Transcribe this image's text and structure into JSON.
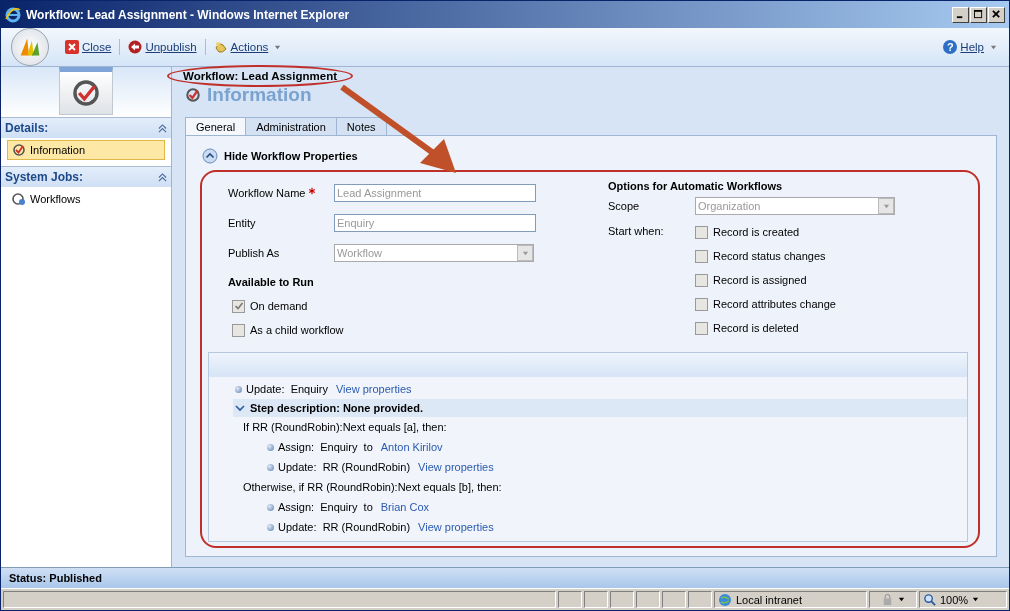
{
  "window": {
    "title": "Workflow: Lead Assignment - Windows Internet Explorer"
  },
  "toolbar": {
    "buttons": [
      {
        "label": "Close",
        "kind": "close"
      },
      {
        "label": "Unpublish",
        "kind": "unpublish"
      },
      {
        "label": "Actions",
        "kind": "menu"
      }
    ],
    "help": "Help",
    "help_glyph": "?"
  },
  "sidebar": {
    "sections": [
      {
        "title": "Details:",
        "items": [
          {
            "label": "Information",
            "selected": true
          }
        ]
      },
      {
        "title": "System Jobs:",
        "items": [
          {
            "label": "Workflows",
            "selected": false
          }
        ]
      }
    ]
  },
  "header": {
    "record": "Workflow: Lead Assignment",
    "title": "Information"
  },
  "tabs": [
    {
      "label": "General",
      "selected": true
    },
    {
      "label": "Administration",
      "selected": false
    },
    {
      "label": "Notes",
      "selected": false
    }
  ],
  "section_toggle": "Hide Workflow Properties",
  "form": {
    "fields": [
      {
        "label": "Workflow Name",
        "required": true,
        "kind": "text",
        "value": "Lead Assignment"
      },
      {
        "label": "Entity",
        "required": false,
        "kind": "text",
        "value": "Enquiry"
      },
      {
        "label": "Publish As",
        "required": false,
        "kind": "select",
        "value": "Workflow"
      }
    ],
    "available_title": "Available to Run",
    "available": [
      {
        "label": "On demand",
        "checked": true
      },
      {
        "label": "As a child workflow",
        "checked": false
      }
    ],
    "options_title": "Options for Automatic Workflows",
    "scope_label": "Scope",
    "scope_value": "Organization",
    "start_label": "Start when:",
    "start_options": [
      {
        "label": "Record is created",
        "checked": false
      },
      {
        "label": "Record status changes",
        "checked": false
      },
      {
        "label": "Record is assigned",
        "checked": false
      },
      {
        "label": "Record attributes change",
        "checked": false
      },
      {
        "label": "Record is deleted",
        "checked": false
      }
    ]
  },
  "steps": [
    {
      "kind": "action",
      "text": "Update:  Enquiry",
      "link": "View properties"
    },
    {
      "kind": "description",
      "text": "Step description: None provided.",
      "expanded": true,
      "children": [
        {
          "kind": "condition",
          "text": "If RR (RoundRobin):Next equals [a], then:",
          "children": [
            {
              "kind": "action",
              "text": "Assign:  Enquiry  to",
              "link": "Anton Kirilov"
            },
            {
              "kind": "action",
              "text": "Update:  RR (RoundRobin)",
              "link": "View properties"
            }
          ]
        },
        {
          "kind": "condition",
          "text": "Otherwise, if RR (RoundRobin):Next equals [b], then:",
          "children": [
            {
              "kind": "action",
              "text": "Assign:  Enquiry  to",
              "link": "Brian Cox"
            },
            {
              "kind": "action",
              "text": "Update:  RR (RoundRobin)",
              "link": "View properties"
            }
          ]
        }
      ]
    }
  ],
  "status": "Status: Published",
  "ie_status": {
    "zone": "Local intranet",
    "zoom": "100%"
  }
}
